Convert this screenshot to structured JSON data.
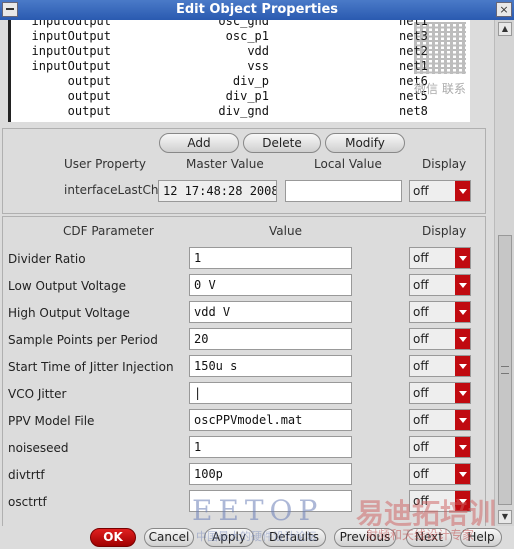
{
  "window": {
    "title": "Edit Object Properties",
    "close_glyph": "×"
  },
  "terminals": [
    {
      "name": "inputOutput",
      "net_expr": "osc_gnd",
      "net": "net1"
    },
    {
      "name": "inputOutput",
      "net_expr": "osc_p1",
      "net": "net3"
    },
    {
      "name": "inputOutput",
      "net_expr": "vdd",
      "net": "net2"
    },
    {
      "name": "inputOutput",
      "net_expr": "vss",
      "net": "net1"
    },
    {
      "name": "output",
      "net_expr": "div_p",
      "net": "net6"
    },
    {
      "name": "output",
      "net_expr": "div_p1",
      "net": "net5"
    },
    {
      "name": "output",
      "net_expr": "div_gnd",
      "net": "net8"
    }
  ],
  "property_buttons": {
    "add": "Add",
    "delete": "Delete",
    "modify": "Modify"
  },
  "property_headers": {
    "user_property": "User Property",
    "master_value": "Master Value",
    "local_value": "Local Value",
    "display": "Display"
  },
  "property_row": {
    "name": "interfaceLastCh..",
    "master_value": "12 17:48:28 2008",
    "local_value": "",
    "display": "off"
  },
  "cdf_headers": {
    "parameter": "CDF Parameter",
    "value": "Value",
    "display": "Display"
  },
  "cdf_params": [
    {
      "label": "Divider Ratio",
      "value": "1",
      "display": "off"
    },
    {
      "label": "Low Output Voltage",
      "value": "0 V",
      "display": "off"
    },
    {
      "label": "High Output Voltage",
      "value": "vdd V",
      "display": "off"
    },
    {
      "label": "Sample Points per Period",
      "value": "20",
      "display": "off"
    },
    {
      "label": "Start Time of Jitter Injection",
      "value": "150u s",
      "display": "off"
    },
    {
      "label": "VCO Jitter",
      "value": "|",
      "display": "off"
    },
    {
      "label": "PPV Model File",
      "value": "oscPPVmodel.mat",
      "display": "off"
    },
    {
      "label": "noiseseed",
      "value": "1",
      "display": "off"
    },
    {
      "label": "divtrtf",
      "value": "100p",
      "display": "off"
    },
    {
      "label": "osctrtf",
      "value": "",
      "display": "off"
    }
  ],
  "bottom_buttons": {
    "ok": "OK",
    "cancel": "Cancel",
    "apply": "Apply",
    "defaults": "Defaults",
    "previous": "Previous",
    "next": "Next",
    "help": "Help"
  },
  "watermarks": {
    "qr_caption": "微信 联系",
    "eetop": "EETOP",
    "eetop_sub": "中国最大的硬件设计论坛",
    "cn_main": "易迪拓培训",
    "cn_sub": "射频和天线设计专家"
  },
  "colors": {
    "title_bar": "#2a5ab0",
    "dropdown_arrow": "#c00a10",
    "ok_button": "#c00000"
  }
}
